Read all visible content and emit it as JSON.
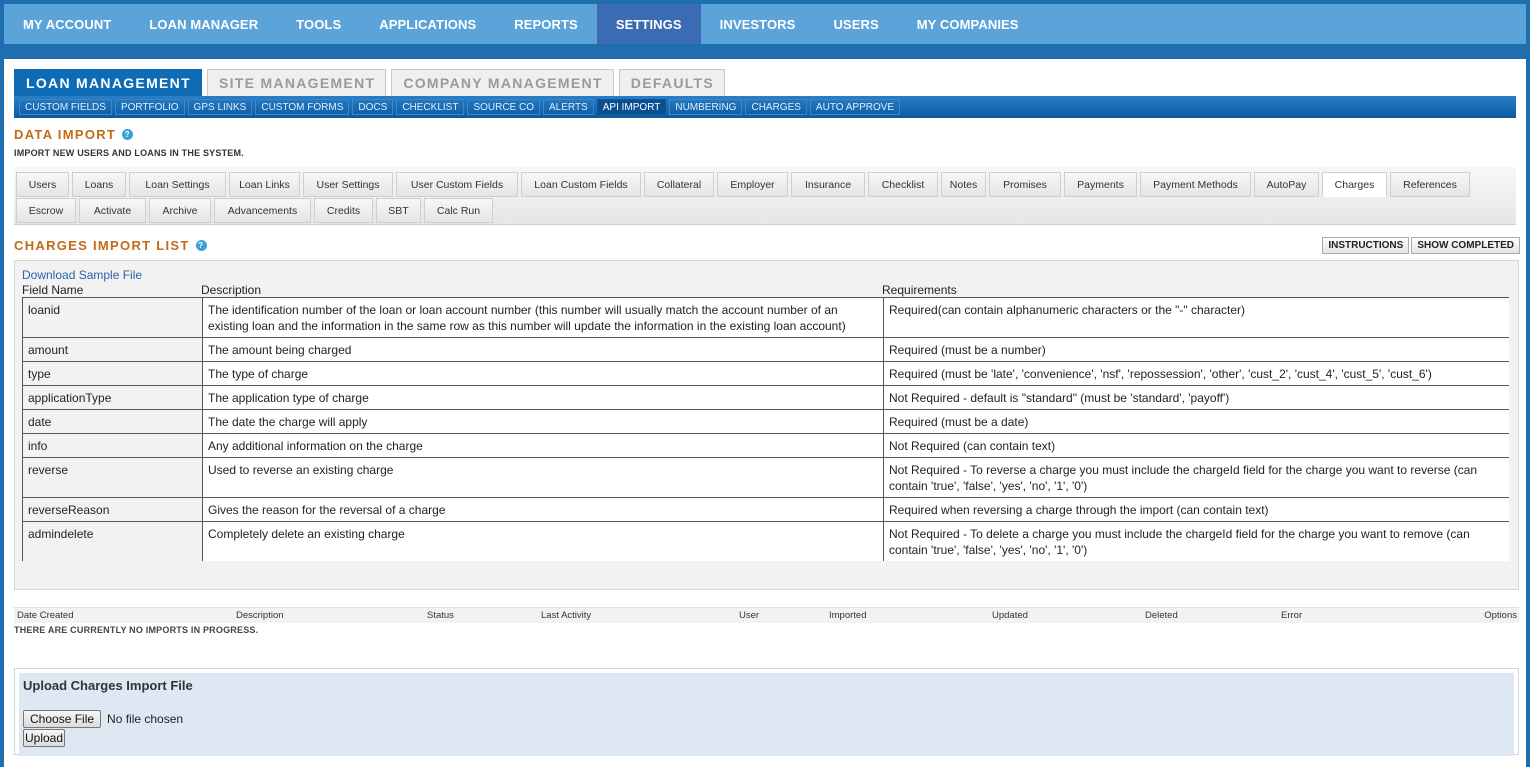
{
  "top_nav": [
    "MY ACCOUNT",
    "LOAN MANAGER",
    "TOOLS",
    "APPLICATIONS",
    "REPORTS",
    "SETTINGS",
    "INVESTORS",
    "USERS",
    "MY COMPANIES"
  ],
  "top_nav_active": "SETTINGS",
  "section_tabs": [
    "LOAN MANAGEMENT",
    "SITE MANAGEMENT",
    "COMPANY MANAGEMENT",
    "DEFAULTS"
  ],
  "sub_nav": [
    "CUSTOM FIELDS",
    "PORTFOLIO",
    "GPS LINKS",
    "CUSTOM FORMS",
    "DOCS",
    "CHECKLIST",
    "SOURCE CO",
    "ALERTS",
    "API IMPORT",
    "NUMBERING",
    "CHARGES",
    "AUTO APPROVE"
  ],
  "data_import": {
    "title": "DATA IMPORT",
    "subtitle": "IMPORT NEW USERS AND LOANS IN THE SYSTEM."
  },
  "import_tabs_row1": [
    "Users",
    "Loans",
    "Loan Settings",
    "Loan Links",
    "User Settings",
    "User Custom Fields",
    "Loan Custom Fields",
    "Collateral",
    "Employer",
    "Insurance",
    "Checklist",
    "Notes",
    "Promises",
    "Payments",
    "Payment Methods",
    "AutoPay",
    "Charges",
    "References"
  ],
  "import_tabs_row2": [
    "Escrow",
    "Activate",
    "Archive",
    "Advancements",
    "Credits",
    "SBT",
    "Calc Run"
  ],
  "charges_list": {
    "title": "CHARGES IMPORT LIST",
    "instructions_btn": "INSTRUCTIONS",
    "show_completed_btn": "SHOW COMPLETED",
    "download_link": "Download Sample File",
    "col_field": "Field Name",
    "col_desc": "Description",
    "col_req": "Requirements",
    "rows": [
      {
        "field": "loanid",
        "desc": "The identification number of the loan or loan account number (this number will usually match the account number of an existing loan and the information in the same row as this number will update the information in the existing loan account)",
        "req": "Required(can contain alphanumeric characters or the \"-\" character)"
      },
      {
        "field": "amount",
        "desc": "The amount being charged",
        "req": "Required (must be a number)"
      },
      {
        "field": "type",
        "desc": "The type of charge",
        "req": "Required (must be 'late', 'convenience', 'nsf', 'repossession', 'other', 'cust_2', 'cust_4', 'cust_5', 'cust_6')"
      },
      {
        "field": "applicationType",
        "desc": "The application type of charge",
        "req": "Not Required - default is \"standard\" (must be 'standard', 'payoff')"
      },
      {
        "field": "date",
        "desc": "The date the charge will apply",
        "req": "Required (must be a date)"
      },
      {
        "field": "info",
        "desc": "Any additional information on the charge",
        "req": "Not Required (can contain text)"
      },
      {
        "field": "reverse",
        "desc": "Used to reverse an existing charge",
        "req": "Not Required - To reverse a charge you must include the chargeId field for the charge you want to reverse (can contain 'true', 'false', 'yes', 'no', '1', '0')"
      },
      {
        "field": "reverseReason",
        "desc": "Gives the reason for the reversal of a charge",
        "req": "Required when reversing a charge through the import (can contain text)"
      },
      {
        "field": "admindelete",
        "desc": "Completely delete an existing charge",
        "req": "Not Required - To delete a charge you must include the chargeId field for the charge you want to remove (can contain 'true', 'false', 'yes', 'no', '1', '0')"
      }
    ]
  },
  "imports_table": {
    "headers": [
      "Date Created",
      "Description",
      "Status",
      "Last Activity",
      "User",
      "Imported",
      "Updated",
      "Deleted",
      "Error",
      "Options"
    ],
    "empty_text": "THERE ARE CURRENTLY NO IMPORTS IN PROGRESS."
  },
  "upload": {
    "title": "Upload Charges Import File",
    "choose_btn": "Choose File",
    "no_file": "No file chosen",
    "upload_btn": "Upload"
  }
}
